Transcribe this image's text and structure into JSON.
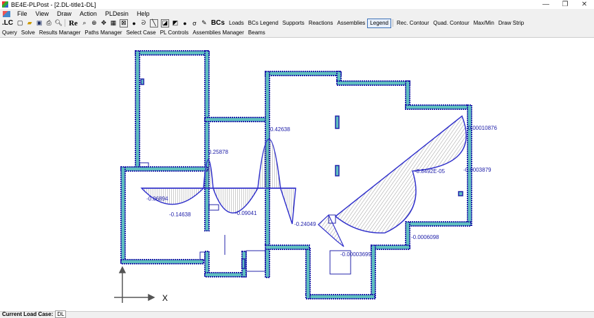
{
  "window": {
    "title": "BE4E-PLPost - [2.DL-title1-DL]",
    "buttons": [
      "—",
      "❐",
      "✕"
    ]
  },
  "menu": [
    "File",
    "View",
    "Draw",
    "Action",
    "PLDesin",
    "Help"
  ],
  "toolbar1": {
    "lc_label": ".LC",
    "re_label": "Re",
    "bcs_label": "BCs",
    "text_buttons": [
      "Loads",
      "BCs Legend",
      "Supports",
      "Reactions",
      "Assemblies",
      "Legend",
      "Rec. Contour",
      "Quad. Contour",
      "Max/Min",
      "Draw Strip"
    ],
    "active_button": "Legend"
  },
  "toolbar2": [
    "Query",
    "Solve",
    "Results Manager",
    "Paths Manager",
    "Select Case",
    "PL Controls",
    "Assemblies Manager",
    "Beams"
  ],
  "diagram": {
    "labels": [
      "-0.06894",
      "-0.14638",
      "0.25878",
      "-0.09041",
      "0.42638",
      "-0.24049",
      "-0.00003699",
      "-8.8492E-05",
      "-0.00010876",
      "-0.0003879",
      "-0.0006098"
    ],
    "axis_label": "X"
  },
  "status": {
    "label": "Current Load Case:",
    "value": "DL"
  },
  "colors": {
    "wall": "#5fbfbf",
    "wall_edge": "#2222aa",
    "diagram": "#3333cc",
    "hatch": "#555555"
  }
}
